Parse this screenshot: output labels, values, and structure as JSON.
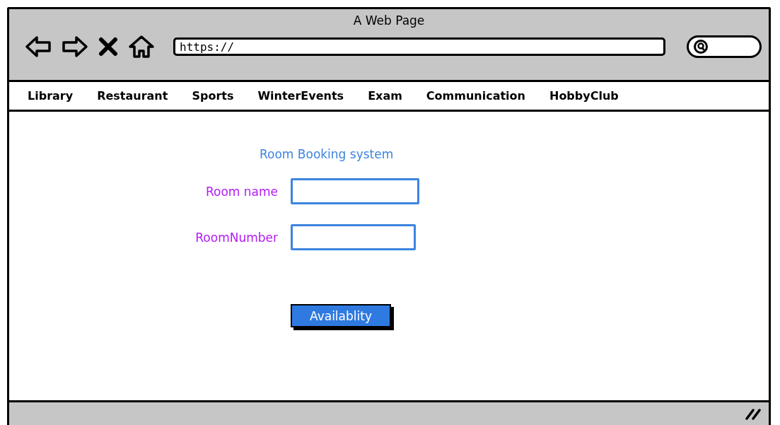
{
  "window": {
    "title": "A Web Page"
  },
  "toolbar": {
    "url": "https://"
  },
  "menu": [
    "Library",
    "Restaurant",
    "Sports",
    "WinterEvents",
    "Exam",
    "Communication",
    "HobbyClub"
  ],
  "form": {
    "title": "Room Booking system",
    "fields": [
      {
        "label": "Room name"
      },
      {
        "label": "RoomNumber"
      }
    ],
    "button": "Availablity"
  }
}
